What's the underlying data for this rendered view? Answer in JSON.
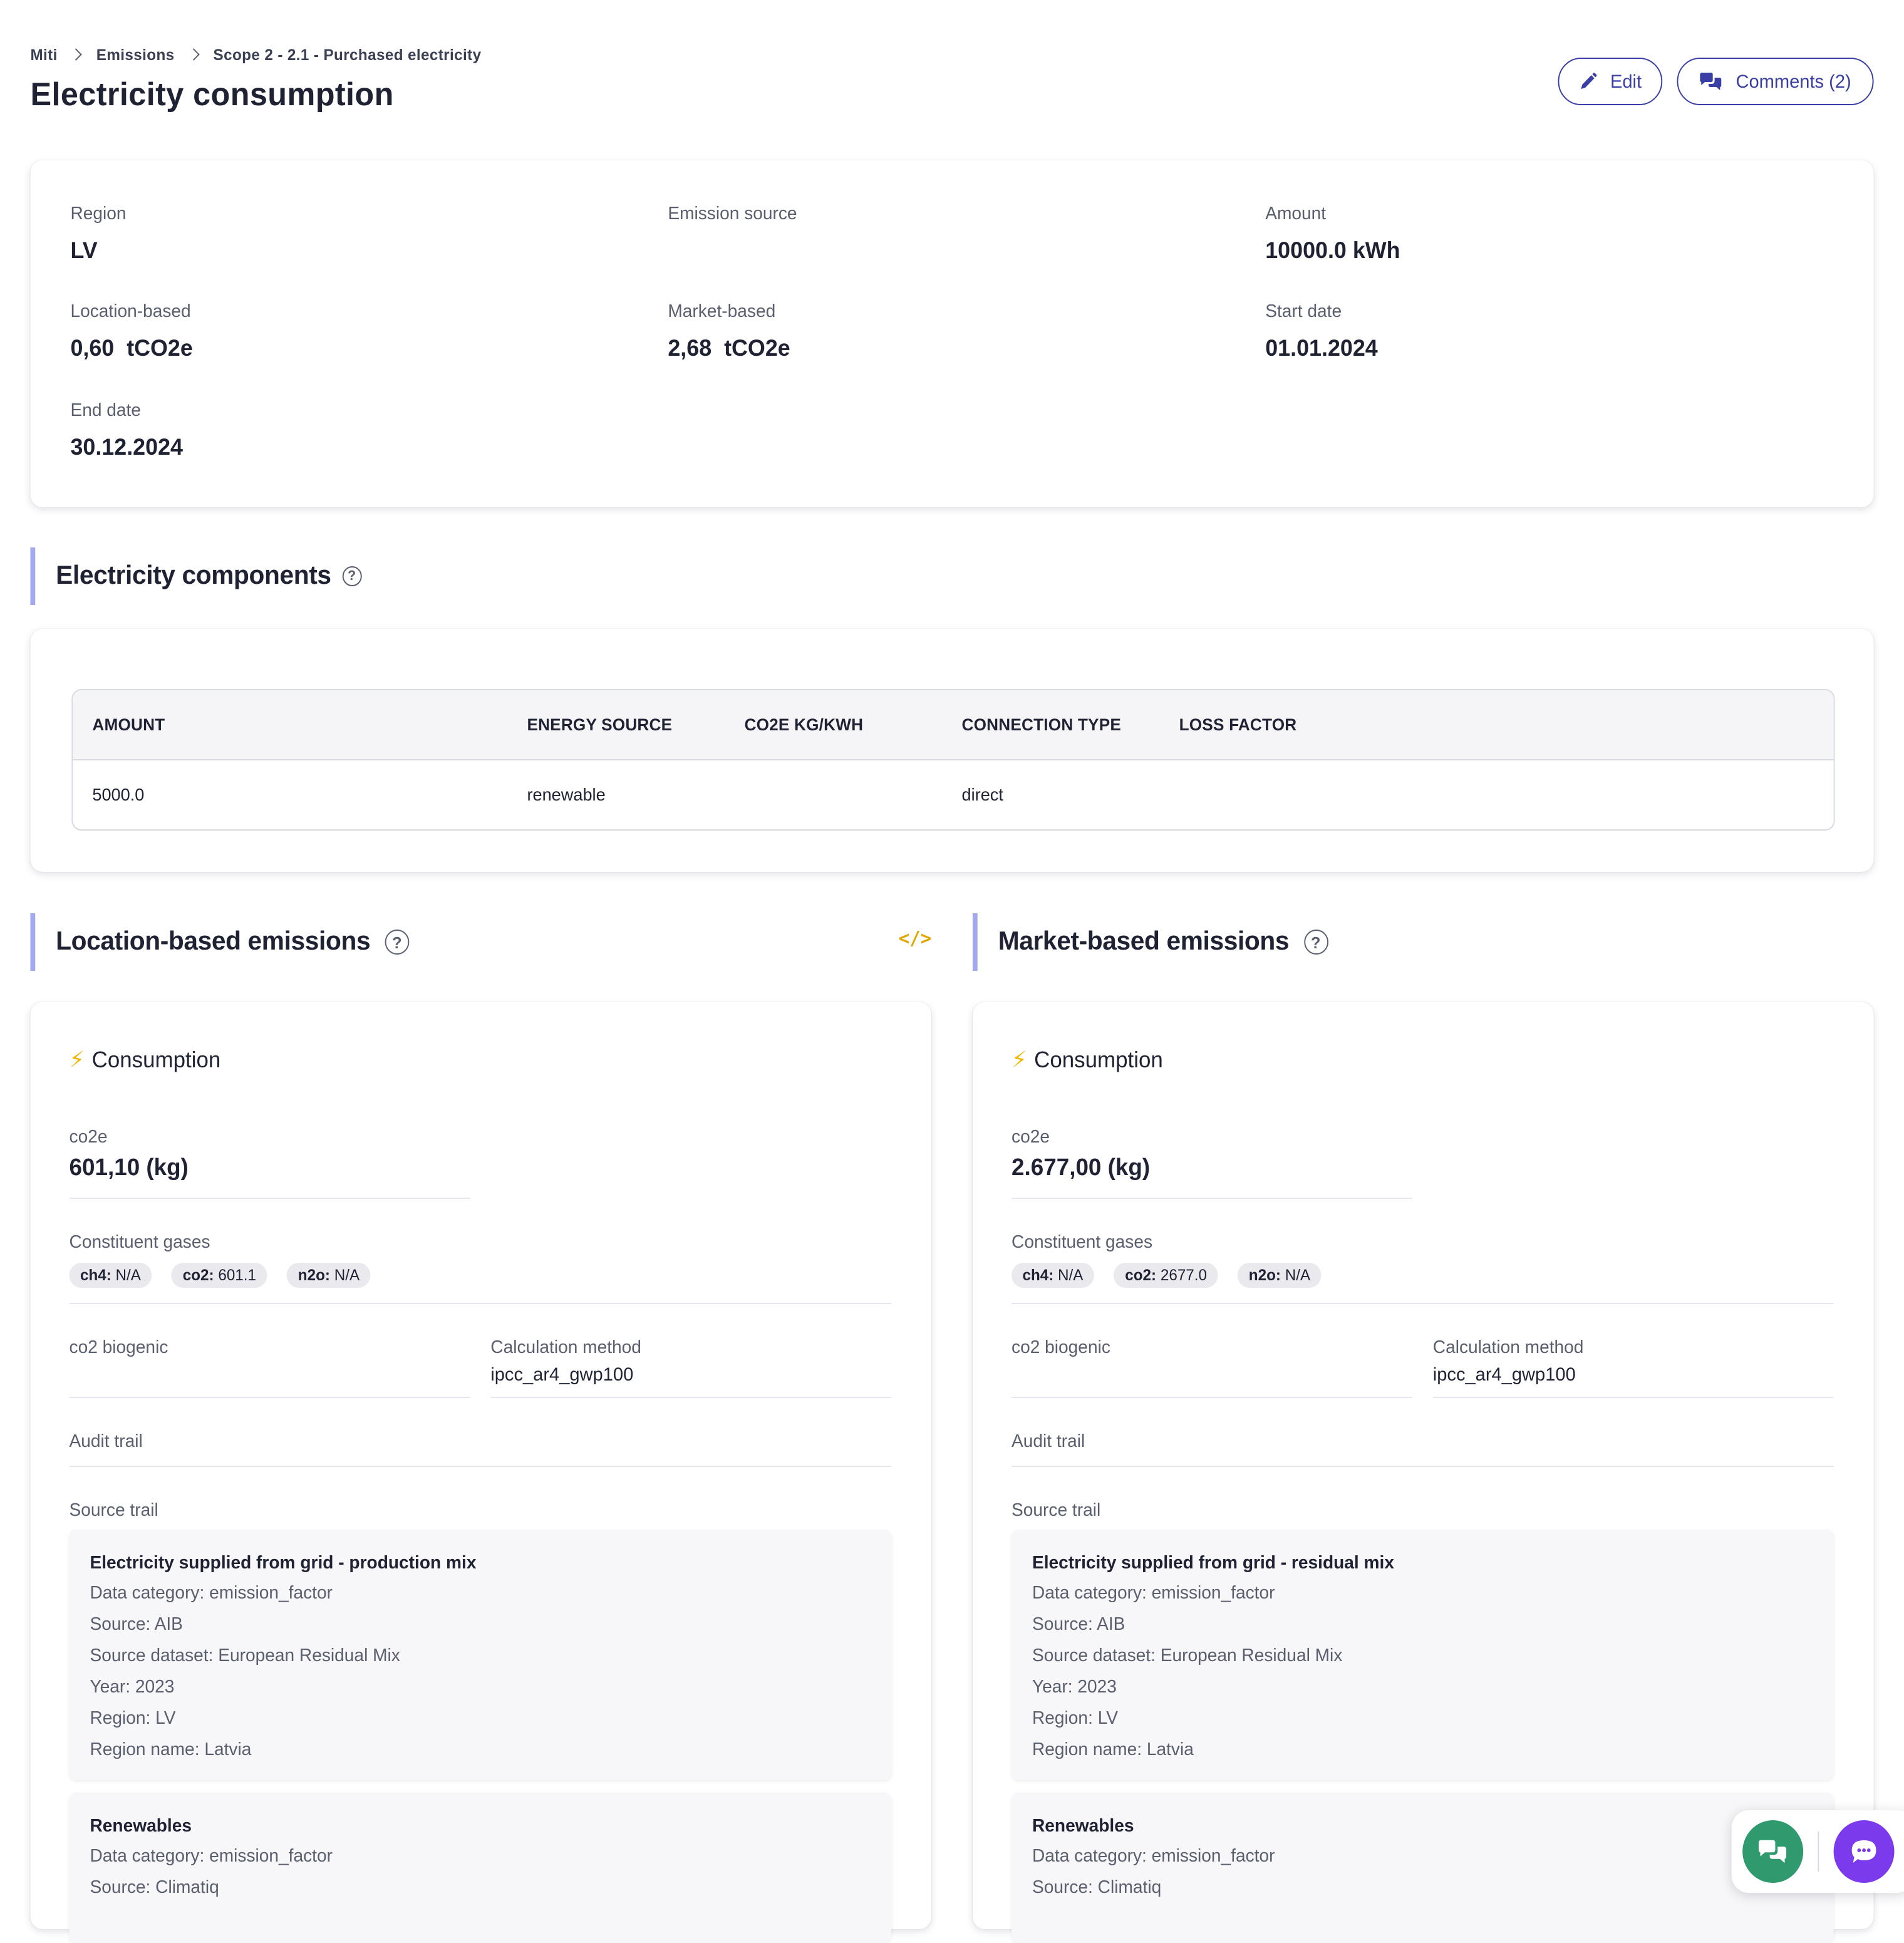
{
  "breadcrumb": [
    "Miti",
    "Emissions",
    "Scope 2 - 2.1 - Purchased electricity"
  ],
  "title": "Electricity consumption",
  "actions": {
    "edit": "Edit",
    "comments": "Comments (2)"
  },
  "summary": {
    "region_label": "Region",
    "region_value": "LV",
    "source_label": "Emission source",
    "source_value": "",
    "amount_label": "Amount",
    "amount_value": "10000.0 kWh",
    "location_label": "Location-based",
    "location_value": "0,60  tCO2e",
    "market_label": "Market-based",
    "market_value": "2,68  tCO2e",
    "start_label": "Start date",
    "start_value": "01.01.2024",
    "end_label": "End date",
    "end_value": "30.12.2024"
  },
  "components": {
    "title": "Electricity components",
    "columns": [
      "AMOUNT",
      "ENERGY SOURCE",
      "CO2E KG/KWH",
      "CONNECTION TYPE",
      "LOSS FACTOR"
    ],
    "rows": [
      [
        "5000.0",
        "renewable",
        "",
        "direct",
        ""
      ]
    ]
  },
  "location": {
    "title": "Location-based emissions",
    "consumption": "Consumption",
    "co2e_label": "co2e",
    "co2e_value": "601,10 (kg)",
    "gases_label": "Constituent gases",
    "gases": [
      {
        "k": "ch4:",
        "v": "N/A"
      },
      {
        "k": "co2:",
        "v": "601.1"
      },
      {
        "k": "n2o:",
        "v": "N/A"
      }
    ],
    "biogenic_label": "co2 biogenic",
    "method_label": "Calculation method",
    "method_value": "ipcc_ar4_gwp100",
    "audit_label": "Audit trail",
    "source_trail_label": "Source trail",
    "trail1": {
      "title": "Electricity supplied from grid - production mix",
      "lines": [
        "Data category: emission_factor",
        "Source: AIB",
        "Source dataset: European Residual Mix",
        "Year: 2023",
        "Region: LV",
        "Region name: Latvia"
      ]
    },
    "trail2": {
      "title": "Renewables",
      "lines": [
        "Data category: emission_factor",
        "Source: Climatiq"
      ]
    }
  },
  "market": {
    "title": "Market-based emissions",
    "consumption": "Consumption",
    "co2e_label": "co2e",
    "co2e_value": "2.677,00 (kg)",
    "gases_label": "Constituent gases",
    "gases": [
      {
        "k": "ch4:",
        "v": "N/A"
      },
      {
        "k": "co2:",
        "v": "2677.0"
      },
      {
        "k": "n2o:",
        "v": "N/A"
      }
    ],
    "biogenic_label": "co2 biogenic",
    "method_label": "Calculation method",
    "method_value": "ipcc_ar4_gwp100",
    "audit_label": "Audit trail",
    "source_trail_label": "Source trail",
    "trail1": {
      "title": "Electricity supplied from grid - residual mix",
      "lines": [
        "Data category: emission_factor",
        "Source: AIB",
        "Source dataset: European Residual Mix",
        "Year: 2023",
        "Region: LV",
        "Region name: Latvia"
      ]
    },
    "trail2": {
      "title": "Renewables",
      "lines": [
        "Data category: emission_factor",
        "Source: Climatiq"
      ]
    }
  },
  "icons": {
    "edit": "pencil-icon",
    "comments": "chat-bubbles-icon",
    "help": "question-circle-icon",
    "code": "code-icon",
    "bolt": "lightning-bolt-icon",
    "float_chat": "chat-bubbles-icon",
    "float_msg": "message-icon"
  },
  "colors": {
    "accent": "#3b3fa5",
    "section_bar": "#a3a8f0",
    "bolt": "#f2b705",
    "green": "#2e9a6e",
    "purple": "#7c3aed"
  }
}
